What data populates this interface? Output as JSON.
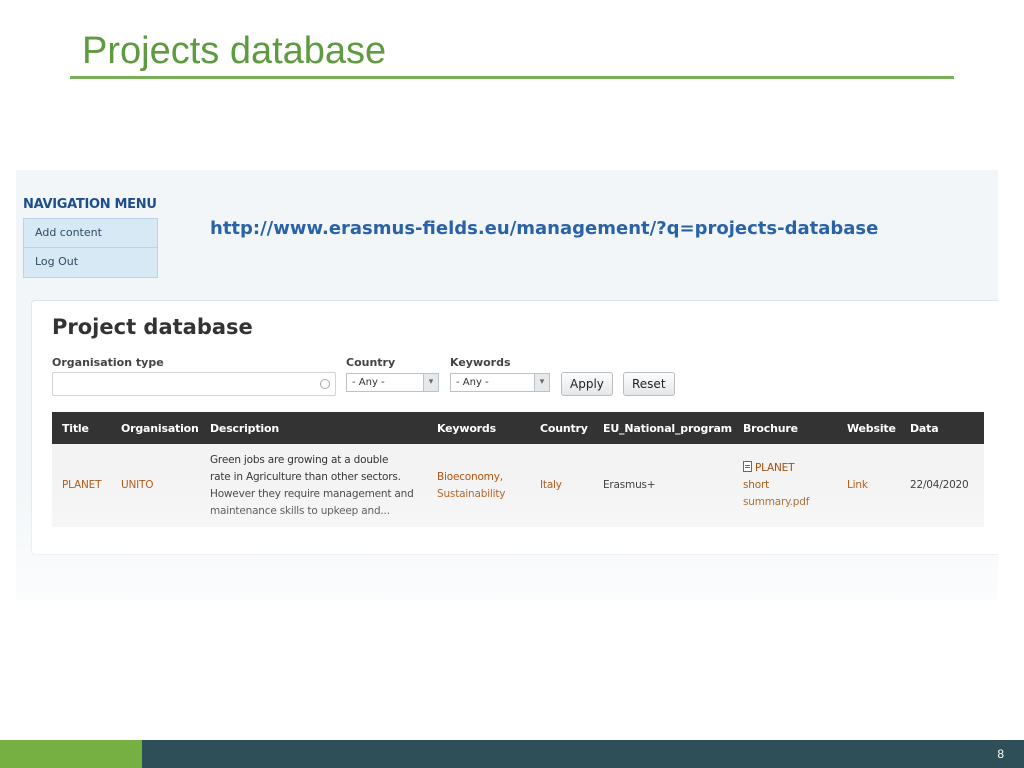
{
  "slide": {
    "title": "Projects database",
    "page_number": "8",
    "colors": {
      "accent_green": "#76b043",
      "footer_dark": "#2f4f58",
      "title_green": "#5e9a3f"
    }
  },
  "screenshot": {
    "nav_menu": {
      "heading": "NAVIGATION MENU",
      "items": [
        {
          "label": "Add content"
        },
        {
          "label": "Log Out"
        }
      ]
    },
    "url": "http://www.erasmus-fields.eu/management/?q=projects-database",
    "project_database": {
      "title": "Project database",
      "filters": {
        "organisation_type_label": "Organisation type",
        "organisation_type_value": "",
        "country_label": "Country",
        "country_value": "- Any -",
        "keywords_label": "Keywords",
        "keywords_value": "- Any -",
        "apply_label": "Apply",
        "reset_label": "Reset"
      },
      "table": {
        "headers": [
          "Title",
          "Organisation",
          "Description",
          "Keywords",
          "Country",
          "EU_National_program",
          "Brochure",
          "Website",
          "Data"
        ],
        "rows": [
          {
            "title": "PLANET",
            "organisation": "UNITO",
            "description_lines": [
              "Green jobs are growing at a double",
              "rate in Agriculture than other sectors.",
              "However they require management and",
              "maintenance skills to upkeep and..."
            ],
            "keywords_lines": [
              "Bioeconomy,",
              "Sustainability"
            ],
            "country": "Italy",
            "program": "Erasmus+",
            "brochure_lines": [
              "PLANET",
              "short",
              "summary.pdf"
            ],
            "website": "Link",
            "data": "22/04/2020"
          }
        ]
      }
    }
  }
}
